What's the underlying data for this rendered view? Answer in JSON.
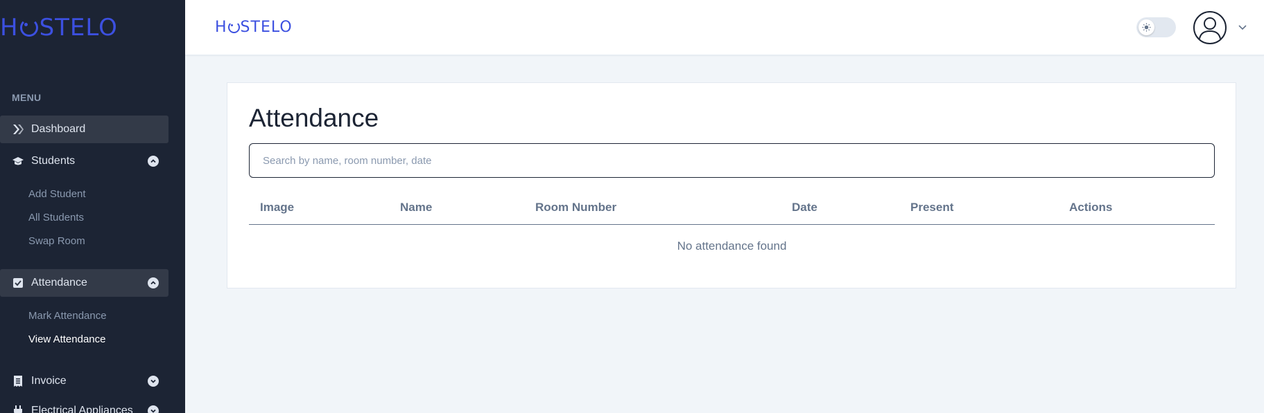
{
  "brand": {
    "name_pre": "H",
    "name_post": "STELO",
    "color": "#3c50e0"
  },
  "sidebar": {
    "menu_label": "MENU",
    "items": [
      {
        "label": "Dashboard",
        "icon": "dashboard-icon"
      },
      {
        "label": "Students",
        "icon": "graduation-cap-icon",
        "expanded": true,
        "children": [
          "Add Student",
          "All Students",
          "Swap Room"
        ]
      },
      {
        "label": "Attendance",
        "icon": "checkbox-icon",
        "expanded": true,
        "children": [
          "Mark Attendance",
          "View Attendance"
        ]
      },
      {
        "label": "Invoice",
        "icon": "receipt-icon",
        "expanded": false
      },
      {
        "label": "Electrical Appliances",
        "icon": "plug-icon",
        "expanded": false
      }
    ],
    "current_sub": "View Attendance"
  },
  "header": {
    "theme_toggle": "light",
    "user_icon": "user-avatar-icon"
  },
  "main": {
    "title": "Attendance",
    "search_placeholder": "Search by name, room number, date",
    "search_value": "",
    "columns": [
      "Image",
      "Name",
      "Room Number",
      "Date",
      "Present",
      "Actions"
    ],
    "rows": [],
    "empty_message": "No attendance found"
  },
  "colors": {
    "sidebar_bg": "#1c2434",
    "page_bg": "#f1f5f9",
    "active_item_bg": "#333a48"
  }
}
